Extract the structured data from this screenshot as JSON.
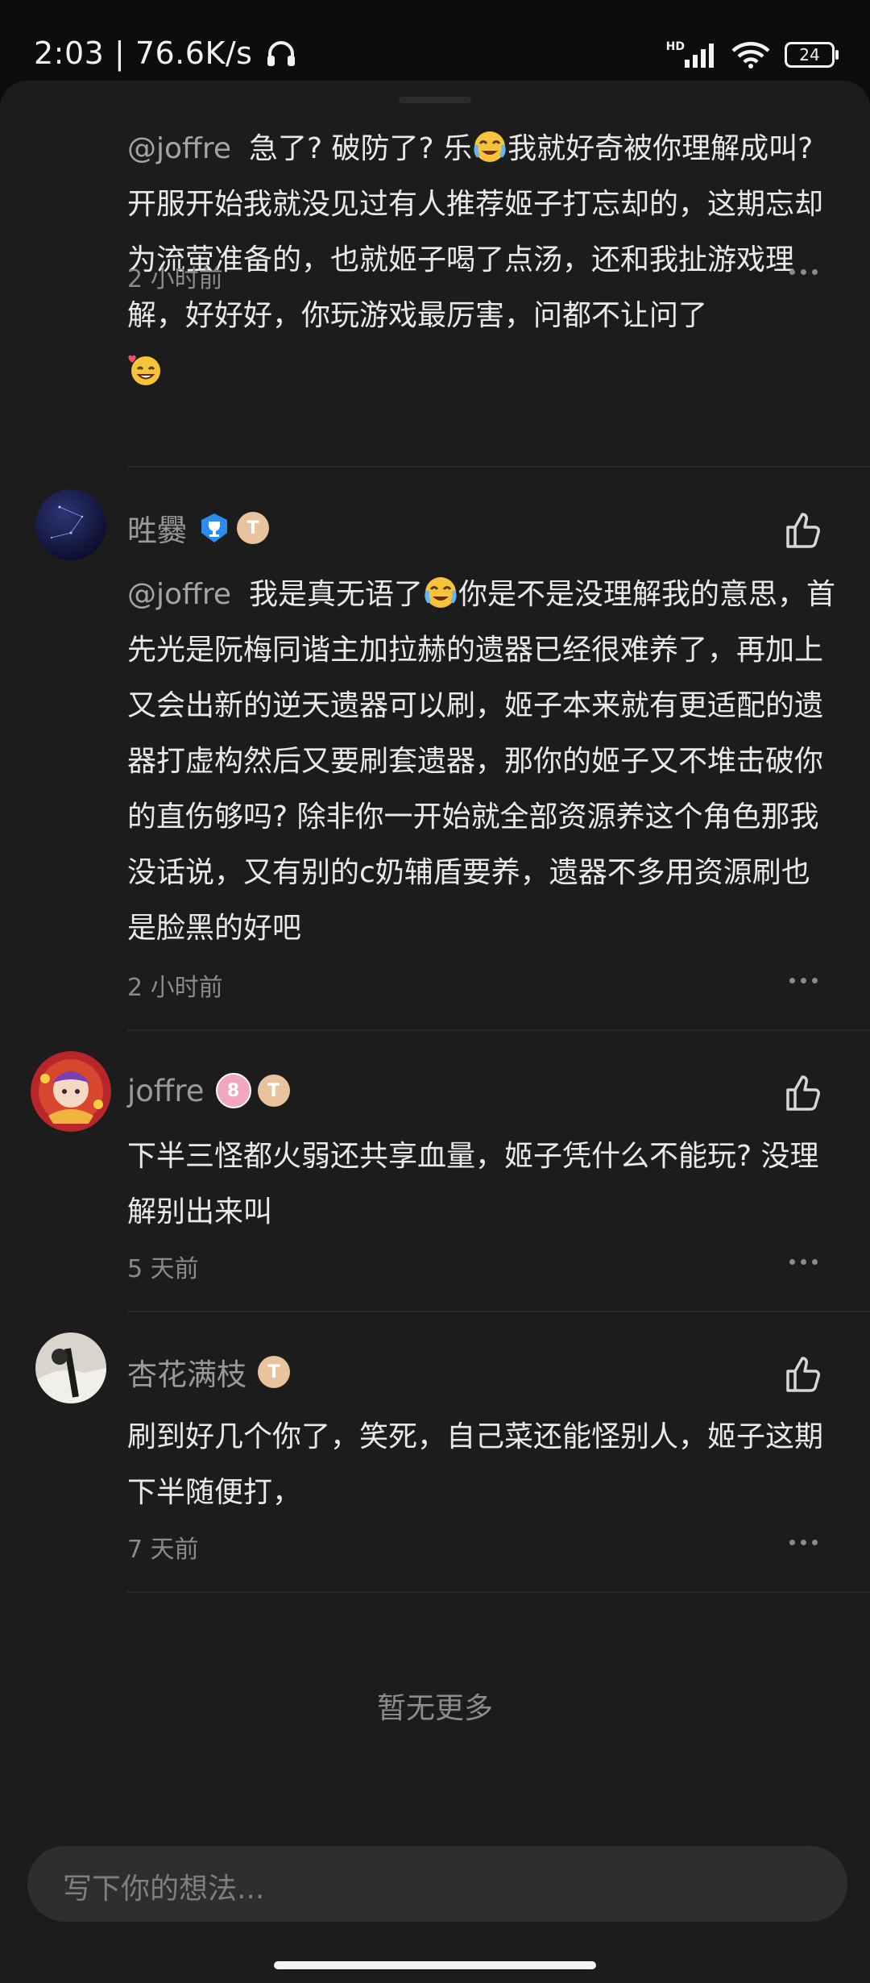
{
  "status_bar": {
    "time": "2:03",
    "network_speed": "76.6K/s",
    "signal_label": "HD",
    "battery": "24",
    "icons": [
      "headphones-icon",
      "signal-icon",
      "wifi-icon",
      "battery-icon"
    ]
  },
  "comments": [
    {
      "mention": "@joffre",
      "text_a": "急了? 破防了? 乐",
      "text_b": "我就好奇被你理解成叫? 开服开始我就没见过有人推荐姬子打忘却的，这期忘却为流萤准备的，也就姬子喝了点汤，还和我扯游戏理解，好好好，你玩游戏最厉害，问都不让问了",
      "time": "2 小时前"
    },
    {
      "name": "甠爨",
      "mention": "@joffre",
      "text_a": "我是真无语了",
      "text_b": "你是不是没理解我的意思，首先光是阮梅同谐主加拉赫的遗器已经很难养了，再加上又会出新的逆天遗器可以刷，姬子本来就有更适配的遗器打虚构然后又要刷套遗器，那你的姬子又不堆击破你的直伤够吗? 除非你一开始就全部资源养这个角色那我没话说，又有别的c奶辅盾要养，遗器不多用资源刷也是脸黑的好吧",
      "time": "2 小时前"
    },
    {
      "name": "joffre",
      "level_badge": "8",
      "text": "下半三怪都火弱还共享血量，姬子凭什么不能玩? 没理解别出来叫",
      "time": "5 天前"
    },
    {
      "name": "杏花满枝",
      "text": "刷到好几个你了，笑死，自己菜还能怪别人，姬子这期下半随便打，",
      "time": "7 天前"
    }
  ],
  "footer": {
    "no_more": "暂无更多",
    "input_placeholder": "写下你的想法..."
  },
  "colors": {
    "background": "#1c1c1c",
    "text": "#e9e9e9",
    "muted": "#8b8b8b",
    "input": "#2e2e2e"
  }
}
